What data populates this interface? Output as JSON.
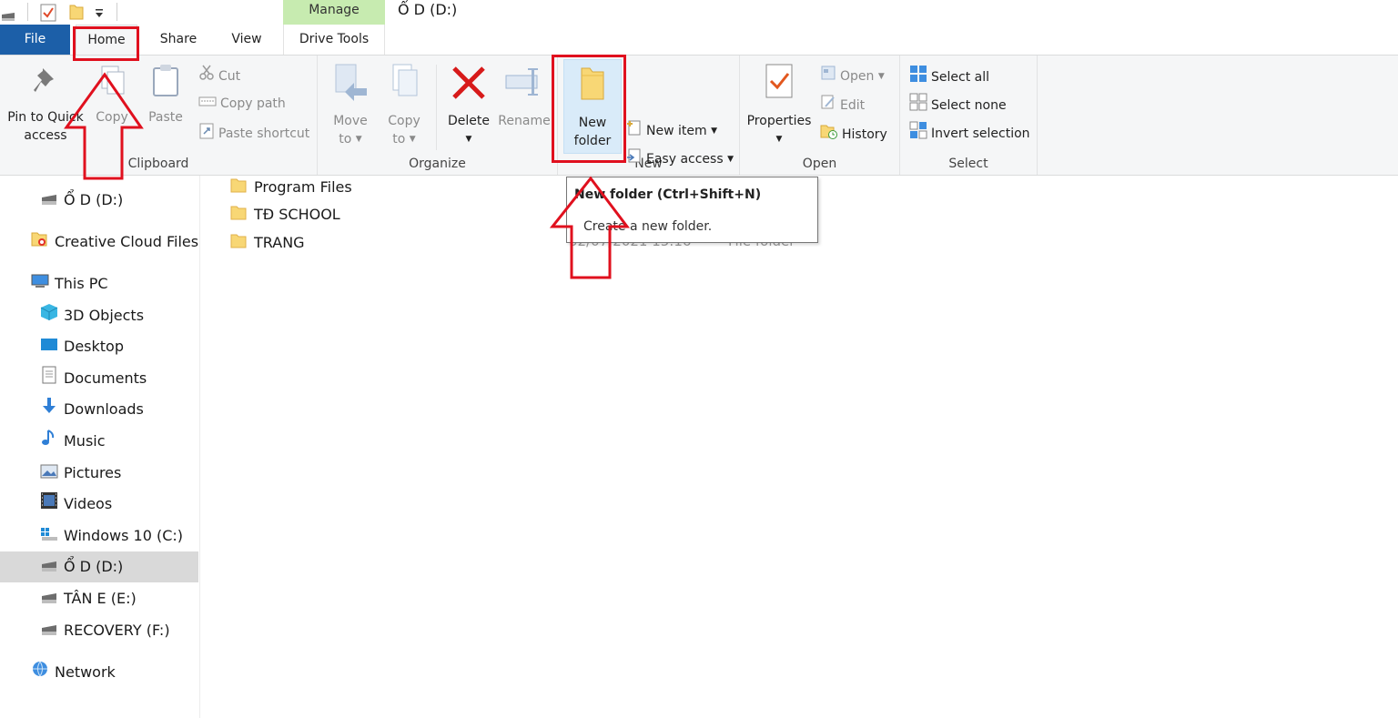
{
  "window": {
    "title": "Ổ D (D:)"
  },
  "contextual_tab": {
    "label": "Manage",
    "color": "#c7ebb0"
  },
  "tabs": {
    "file": "File",
    "home": "Home",
    "share": "Share",
    "view": "View",
    "drive_tools": "Drive Tools"
  },
  "ribbon": {
    "clipboard": {
      "label": "Clipboard",
      "pin_line1": "Pin to Quick",
      "pin_line2": "access",
      "copy": "Copy",
      "paste": "Paste",
      "cut": "Cut",
      "copy_path": "Copy path",
      "paste_shortcut": "Paste shortcut"
    },
    "organize": {
      "label": "Organize",
      "move_line1": "Move",
      "move_line2": "to",
      "copy_line1": "Copy",
      "copy_line2": "to",
      "delete": "Delete",
      "rename": "Rename"
    },
    "new": {
      "label": "New",
      "new_folder_line1": "New",
      "new_folder_line2": "folder",
      "new_item": "New item",
      "easy_access": "Easy access"
    },
    "open": {
      "label": "Open",
      "properties": "Properties",
      "open": "Open",
      "edit": "Edit",
      "history": "History"
    },
    "select": {
      "label": "Select",
      "select_all": "Select all",
      "select_none": "Select none",
      "invert_selection": "Invert selection"
    }
  },
  "tooltip": {
    "title": "New folder (Ctrl+Shift+N)",
    "description": "Create a new folder."
  },
  "nav": {
    "items": [
      {
        "label": "Ổ D (D:)",
        "icon": "drive-icon"
      },
      {
        "label": "Creative Cloud Files",
        "icon": "creative-cloud-icon"
      },
      {
        "label": "This PC",
        "icon": "computer-icon"
      },
      {
        "label": "3D Objects",
        "icon": "3d-objects-icon"
      },
      {
        "label": "Desktop",
        "icon": "desktop-icon"
      },
      {
        "label": "Documents",
        "icon": "documents-icon"
      },
      {
        "label": "Downloads",
        "icon": "downloads-icon"
      },
      {
        "label": "Music",
        "icon": "music-icon"
      },
      {
        "label": "Pictures",
        "icon": "pictures-icon"
      },
      {
        "label": "Videos",
        "icon": "videos-icon"
      },
      {
        "label": "Windows 10 (C:)",
        "icon": "windows-drive-icon"
      },
      {
        "label": "Ổ D (D:)",
        "icon": "drive-icon"
      },
      {
        "label": "TÂN E (E:)",
        "icon": "drive-icon"
      },
      {
        "label": "RECOVERY (F:)",
        "icon": "drive-icon"
      },
      {
        "label": "Network",
        "icon": "network-icon"
      }
    ],
    "selected_label": "Ổ D (D:)"
  },
  "files": {
    "rows": [
      {
        "name": "Program Files"
      },
      {
        "name": "TĐ SCHOOL"
      },
      {
        "name": "TRANG"
      }
    ],
    "obscured_date": "02/07/2021 15:16",
    "obscured_type": "File folder"
  },
  "colors": {
    "accent": "#1c5fa8",
    "annotation": "#e0101e",
    "folder": "#f8d775"
  }
}
